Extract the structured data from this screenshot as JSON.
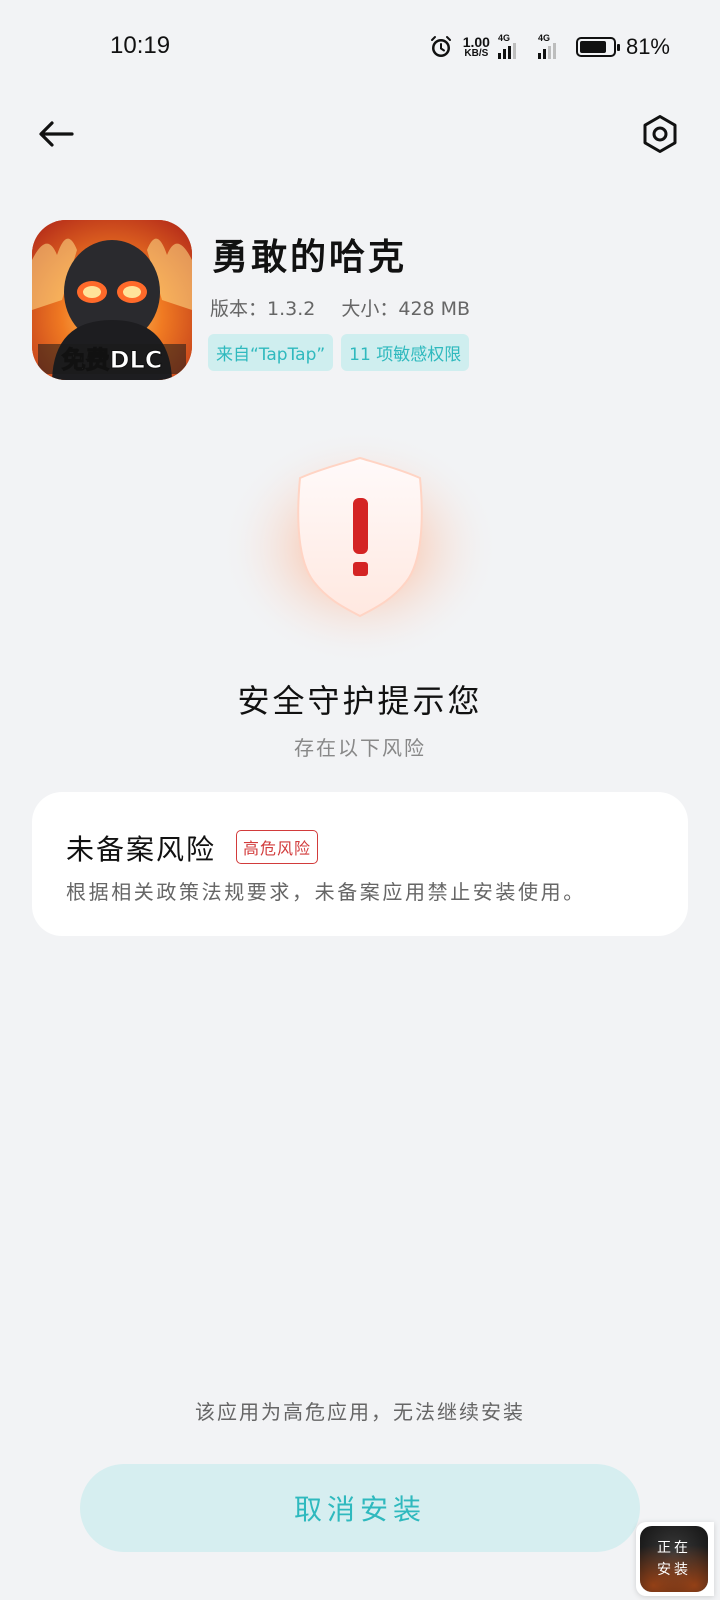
{
  "status_bar": {
    "time": "10:19",
    "net_speed_value": "1.00",
    "net_speed_unit": "KB/S",
    "signal1_label": "4G",
    "signal2_label": "4G",
    "battery_percent": "81%",
    "battery_level": 0.81
  },
  "header": {
    "back_icon": "arrow-left-icon",
    "settings_icon": "hexagon-settings-icon"
  },
  "app": {
    "name": "勇敢的哈克",
    "version": "版本：1.3.2",
    "size": "大小：428 MB",
    "icon_text": "免费DLC",
    "chips": [
      "来自“TapTap”",
      "11 项敏感权限"
    ]
  },
  "warning": {
    "title": "安全守护提示您",
    "subtitle": "存在以下风险"
  },
  "risk": {
    "title": "未备案风险",
    "badge": "高危风险",
    "description": "根据相关政策法规要求，未备案应用禁止安装使用。"
  },
  "footer": {
    "note": "该应用为高危应用，无法继续安装",
    "cancel_label": "取消安装"
  },
  "install_widget": {
    "line1": "正在",
    "line2": "安装"
  },
  "colors": {
    "accent": "#2fb9be",
    "chip_bg": "#cfeeef",
    "danger": "#d23b3b",
    "background": "#f2f3f5"
  }
}
